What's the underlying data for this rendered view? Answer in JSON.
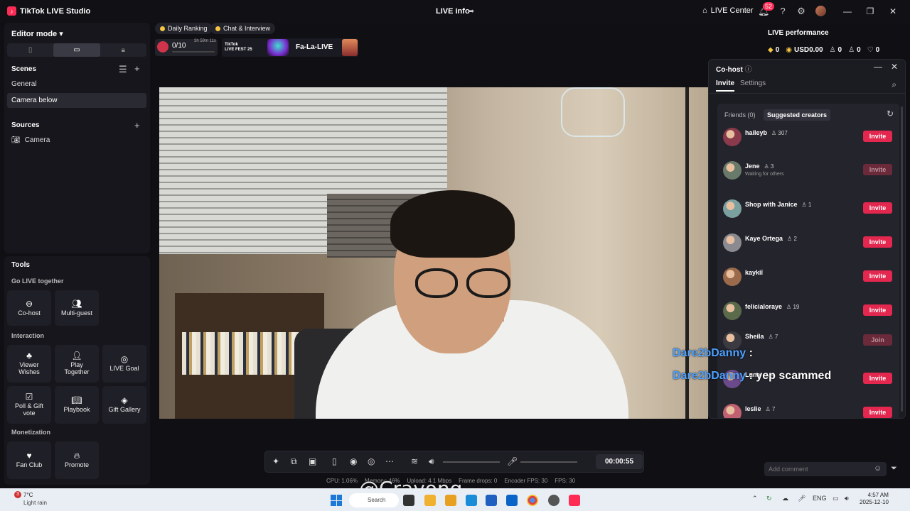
{
  "titlebar": {
    "app_title": "TikTok LIVE Studio",
    "center_title": "LIVE info",
    "live_center": "LIVE Center",
    "notifications_count": "52"
  },
  "left": {
    "editor_mode": "Editor mode",
    "scenes_title": "Scenes",
    "scenes": [
      "General",
      "Camera below"
    ],
    "selected_scene": "Camera below",
    "sources_title": "Sources",
    "sources": [
      "Camera"
    ]
  },
  "tools": {
    "title": "Tools",
    "groups": [
      {
        "name": "Go LIVE together",
        "items": [
          "Co-host",
          "Multi-guest"
        ]
      },
      {
        "name": "Interaction",
        "items": [
          "Viewer Wishes",
          "Play Together",
          "LIVE Goal",
          "Poll & Gift vote",
          "Playbook",
          "Gift Gallery"
        ]
      },
      {
        "name": "Monetization",
        "items": [
          "Fan Club",
          "Promote"
        ]
      }
    ]
  },
  "top_chips": {
    "ranking": "Daily Ranking",
    "chat": "Chat & Interview"
  },
  "gift_goal": {
    "count": "0/10",
    "timer": "3h 59m 11s",
    "progress": 0
  },
  "banner": {
    "logo_line1": "TikTok",
    "logo_line2": "LIVE FEST 25",
    "text": "Fa-La-LIVE"
  },
  "performance": {
    "title": "LIVE performance",
    "coins": "0",
    "earnings": "USD0.00",
    "viewers": "0",
    "new_followers": "0",
    "likes": "0"
  },
  "cohost": {
    "title": "Co-host",
    "tabs": [
      "Invite",
      "Settings"
    ],
    "active_tab": "Invite",
    "subtabs": [
      "Friends (0)",
      "Suggested creators"
    ],
    "active_subtab": "Suggested creators",
    "creators": [
      {
        "name": "haileyb",
        "followers": "307",
        "sub": "",
        "button": "Invite",
        "enabled": true
      },
      {
        "name": "Jene",
        "followers": "3",
        "sub": "Waiting for others",
        "button": "Invite",
        "enabled": false
      },
      {
        "name": "Shop with Janice",
        "followers": "1",
        "sub": "",
        "button": "Invite",
        "enabled": true
      },
      {
        "name": "Kaye Ortega",
        "followers": "2",
        "sub": "",
        "button": "Invite",
        "enabled": true
      },
      {
        "name": "kaykiī",
        "followers": "",
        "sub": "",
        "button": "Invite",
        "enabled": true
      },
      {
        "name": "felicialoraye",
        "followers": "19",
        "sub": "",
        "button": "Invite",
        "enabled": true
      },
      {
        "name": "Sheila",
        "followers": "7",
        "sub": "",
        "button": "Join",
        "enabled": false
      },
      {
        "name": "Luna",
        "followers": "4",
        "sub": "",
        "button": "Invite",
        "enabled": true
      },
      {
        "name": "leslie",
        "followers": "7",
        "sub": "",
        "button": "Invite",
        "enabled": true
      }
    ]
  },
  "overlay_comments": [
    {
      "user": "Dare2bDanny",
      "text": " :"
    },
    {
      "user": "Dare2bDanny",
      "text": " : yep scammed"
    }
  ],
  "controls": {
    "timer": "00:00:55",
    "stats": {
      "cpu": "CPU: 1.06%",
      "memory": "Memory: 46%",
      "upload": "Upload: 4.1 Mbps",
      "frame_drops": "Frame drops: 0",
      "encoder_fps": "Encoder FPS: 30",
      "fps": "FPS: 30"
    }
  },
  "watermark": "@Crayong",
  "comment_input": {
    "placeholder": "Add comment"
  },
  "taskbar": {
    "weather_temp": "7°C",
    "weather_desc": "Light rain",
    "weather_badge": "3",
    "search": "Search",
    "lang": "ENG",
    "time": "4:57 AM",
    "date": "2025-12-10"
  },
  "colors": {
    "accent": "#fe2c55",
    "invite": "#e4274f",
    "comment_user": "#4ea1ff"
  }
}
